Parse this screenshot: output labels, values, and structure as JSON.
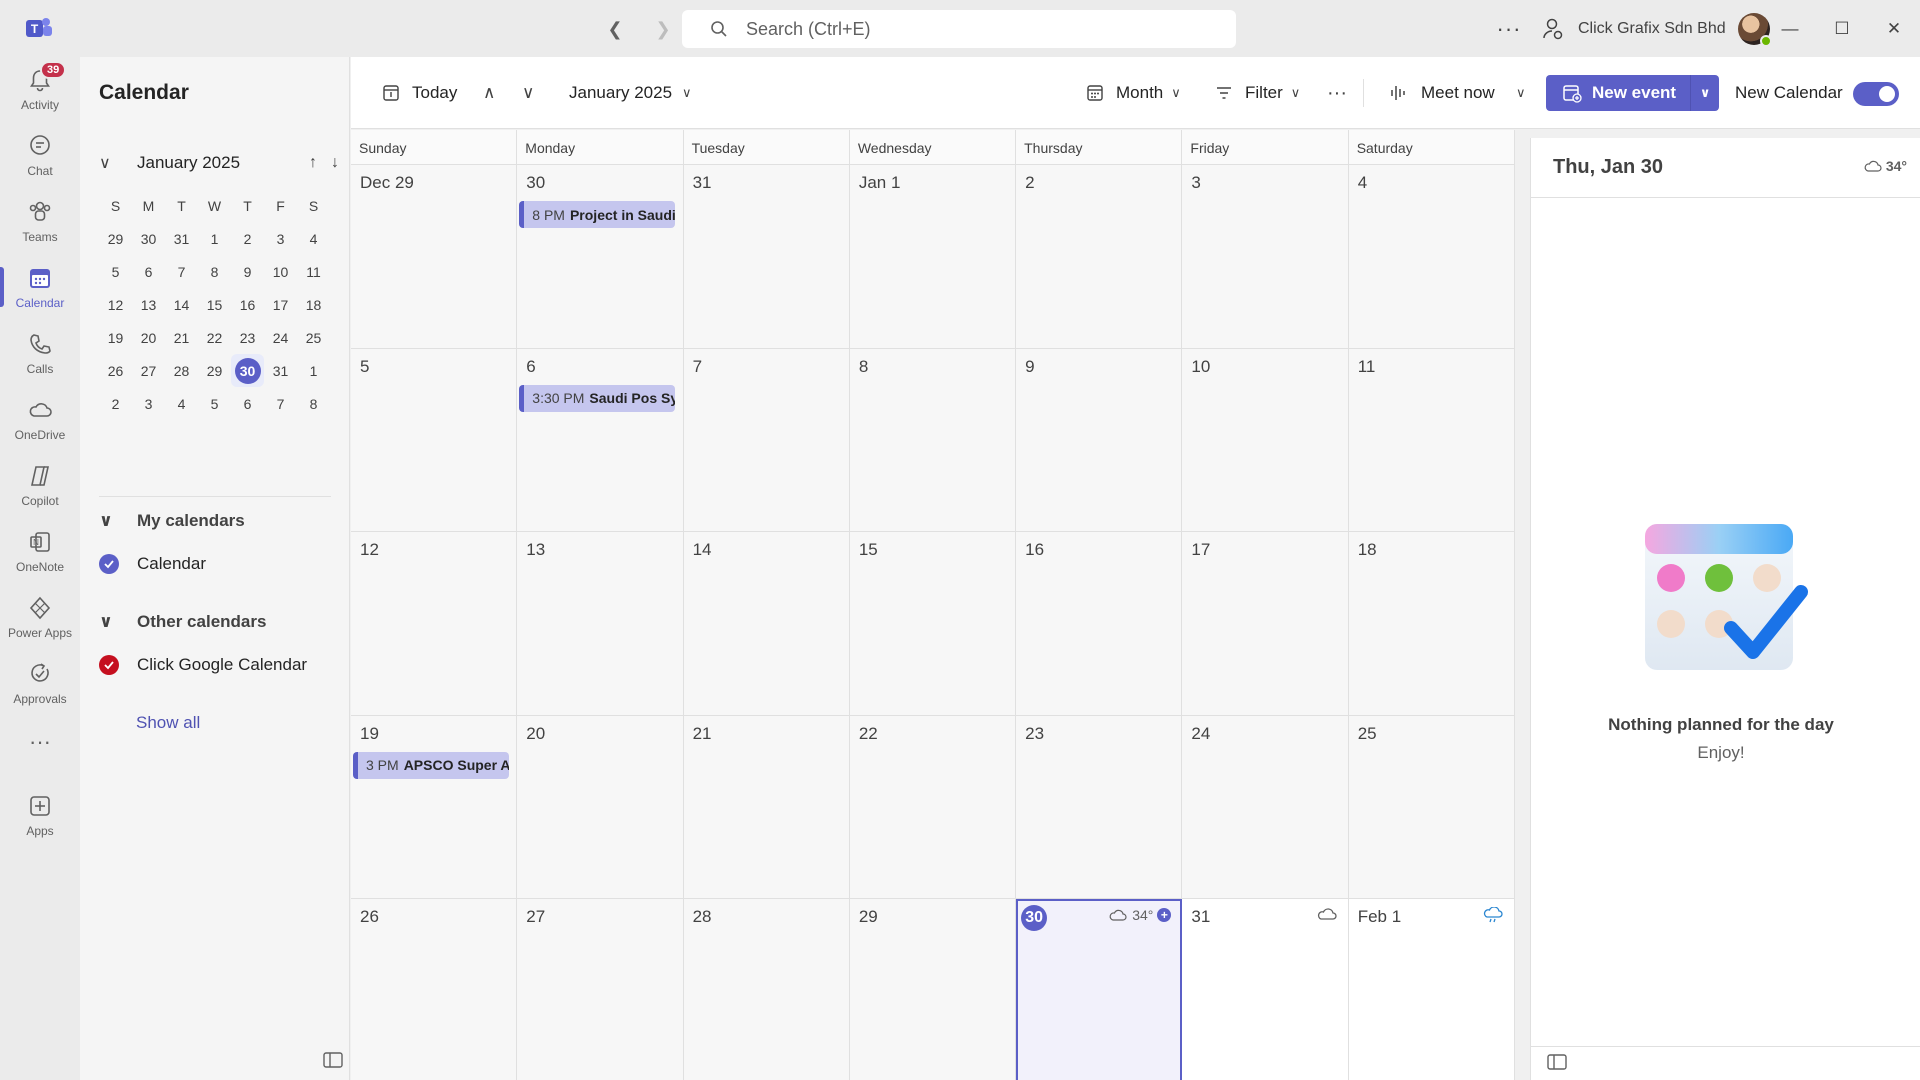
{
  "titlebar": {
    "search_placeholder": "Search (Ctrl+E)",
    "more": "···",
    "org_name": "Click Grafix Sdn Bhd"
  },
  "rail": [
    {
      "label": "Activity",
      "icon": "bell-icon",
      "badge": "39"
    },
    {
      "label": "Chat",
      "icon": "chat-icon"
    },
    {
      "label": "Teams",
      "icon": "teams-icon"
    },
    {
      "label": "Calendar",
      "icon": "calendar-icon",
      "active": true
    },
    {
      "label": "Calls",
      "icon": "phone-icon"
    },
    {
      "label": "OneDrive",
      "icon": "cloud-icon"
    },
    {
      "label": "Copilot",
      "icon": "copilot-icon"
    },
    {
      "label": "OneNote",
      "icon": "onenote-icon"
    },
    {
      "label": "Power Apps",
      "icon": "powerapps-icon"
    },
    {
      "label": "Approvals",
      "icon": "approvals-icon"
    },
    {
      "label": "···",
      "icon": "more-icon"
    },
    {
      "label": "Apps",
      "icon": "add-apps-icon"
    }
  ],
  "leftpane": {
    "title": "Calendar",
    "mini_month": "January 2025",
    "dow": [
      "S",
      "M",
      "T",
      "W",
      "T",
      "F",
      "S"
    ],
    "days": [
      [
        "29",
        "30",
        "31",
        "1",
        "2",
        "3",
        "4"
      ],
      [
        "5",
        "6",
        "7",
        "8",
        "9",
        "10",
        "11"
      ],
      [
        "12",
        "13",
        "14",
        "15",
        "16",
        "17",
        "18"
      ],
      [
        "19",
        "20",
        "21",
        "22",
        "23",
        "24",
        "25"
      ],
      [
        "26",
        "27",
        "28",
        "29",
        "30",
        "31",
        "1"
      ],
      [
        "2",
        "3",
        "4",
        "5",
        "6",
        "7",
        "8"
      ]
    ],
    "selected_day": "30",
    "my_calendars_label": "My calendars",
    "my_calendar_item": "Calendar",
    "other_calendars_label": "Other calendars",
    "other_calendar_item": "Click Google Calendar",
    "show_all": "Show all",
    "colors": {
      "my": "#5b5fc7",
      "other": "#c50f1f"
    }
  },
  "toolbar": {
    "today": "Today",
    "month_label": "January 2025",
    "view": "Month",
    "filter": "Filter",
    "more": "···",
    "meet_now": "Meet now",
    "new_event": "New event",
    "new_calendar": "New Calendar",
    "new_calendar_enabled": true
  },
  "grid": {
    "dow": [
      "Sunday",
      "Monday",
      "Tuesday",
      "Wednesday",
      "Thursday",
      "Friday",
      "Saturday"
    ],
    "weeks": [
      [
        "Dec 29",
        "30",
        "31",
        "Jan 1",
        "2",
        "3",
        "4"
      ],
      [
        "5",
        "6",
        "7",
        "8",
        "9",
        "10",
        "11"
      ],
      [
        "12",
        "13",
        "14",
        "15",
        "16",
        "17",
        "18"
      ],
      [
        "19",
        "20",
        "21",
        "22",
        "23",
        "24",
        "25"
      ],
      [
        "26",
        "27",
        "28",
        "29",
        "30",
        "31",
        "Feb 1"
      ]
    ],
    "events": [
      {
        "week": 0,
        "day": 1,
        "time": "8 PM",
        "title": "Project in Saudi"
      },
      {
        "week": 1,
        "day": 1,
        "time": "3:30 PM",
        "title": "Saudi Pos Sys"
      },
      {
        "week": 3,
        "day": 0,
        "time": "3 PM",
        "title": "APSCO Super Ap"
      }
    ],
    "today_weather": "34°",
    "accent": "#5b5fc7"
  },
  "agenda": {
    "date": "Thu, Jan 30",
    "weather": "34°",
    "empty_title": "Nothing planned for the day",
    "empty_sub": "Enjoy!"
  }
}
